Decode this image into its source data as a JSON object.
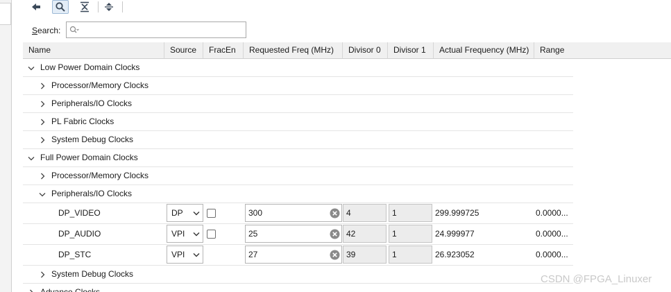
{
  "toolbar": {
    "buttons": [
      {
        "name": "back-button",
        "icon": "arrow-left-icon"
      },
      {
        "name": "search-toggle-button",
        "icon": "search-icon",
        "active": true
      },
      {
        "name": "collapse-all-button",
        "icon": "collapse-all-icon"
      },
      {
        "name": "expand-all-button",
        "icon": "expand-all-icon"
      }
    ]
  },
  "search": {
    "label_mnemonic": "S",
    "label_rest": "earch:",
    "value": "",
    "placeholder": ""
  },
  "columns": [
    "Name",
    "Source",
    "FracEn",
    "Requested Freq (MHz)",
    "Divisor 0",
    "Divisor 1",
    "Actual Frequency (MHz)",
    "Range"
  ],
  "tree": {
    "lpd": {
      "label": "Low Power Domain Clocks",
      "expanded": true,
      "children": [
        {
          "label": "Processor/Memory Clocks",
          "expanded": false
        },
        {
          "label": "Peripherals/IO Clocks",
          "expanded": false
        },
        {
          "label": "PL Fabric Clocks",
          "expanded": false
        },
        {
          "label": "System Debug Clocks",
          "expanded": false
        }
      ]
    },
    "fpd": {
      "label": "Full Power Domain Clocks",
      "expanded": true,
      "children": [
        {
          "label": "Processor/Memory Clocks",
          "expanded": false
        },
        {
          "label": "Peripherals/IO Clocks",
          "expanded": true
        },
        {
          "label": "System Debug Clocks",
          "expanded": false
        }
      ]
    },
    "advanced": {
      "label": "Advance Clocks"
    }
  },
  "clocks": [
    {
      "name": "DP_VIDEO",
      "source": "DP",
      "fracen": false,
      "requested": "300",
      "div0": "4",
      "div1": "1",
      "actual": "299.999725",
      "range": "0.0000..."
    },
    {
      "name": "DP_AUDIO",
      "source": "VPI",
      "fracen": false,
      "requested": "25",
      "div0": "42",
      "div1": "1",
      "actual": "24.999977",
      "range": "0.0000..."
    },
    {
      "name": "DP_STC",
      "source": "VPI",
      "requested": "27",
      "div0": "39",
      "div1": "1",
      "actual": "26.923052",
      "range": "0.0000..."
    }
  ],
  "watermark": "CSDN @FPGA_Linuxer",
  "colors": {
    "toolbar_icon": "#3c4a5a",
    "active_bg": "#e3edf7",
    "readonly_bg": "#ececec",
    "clear_icon": "#8a8a8a"
  }
}
